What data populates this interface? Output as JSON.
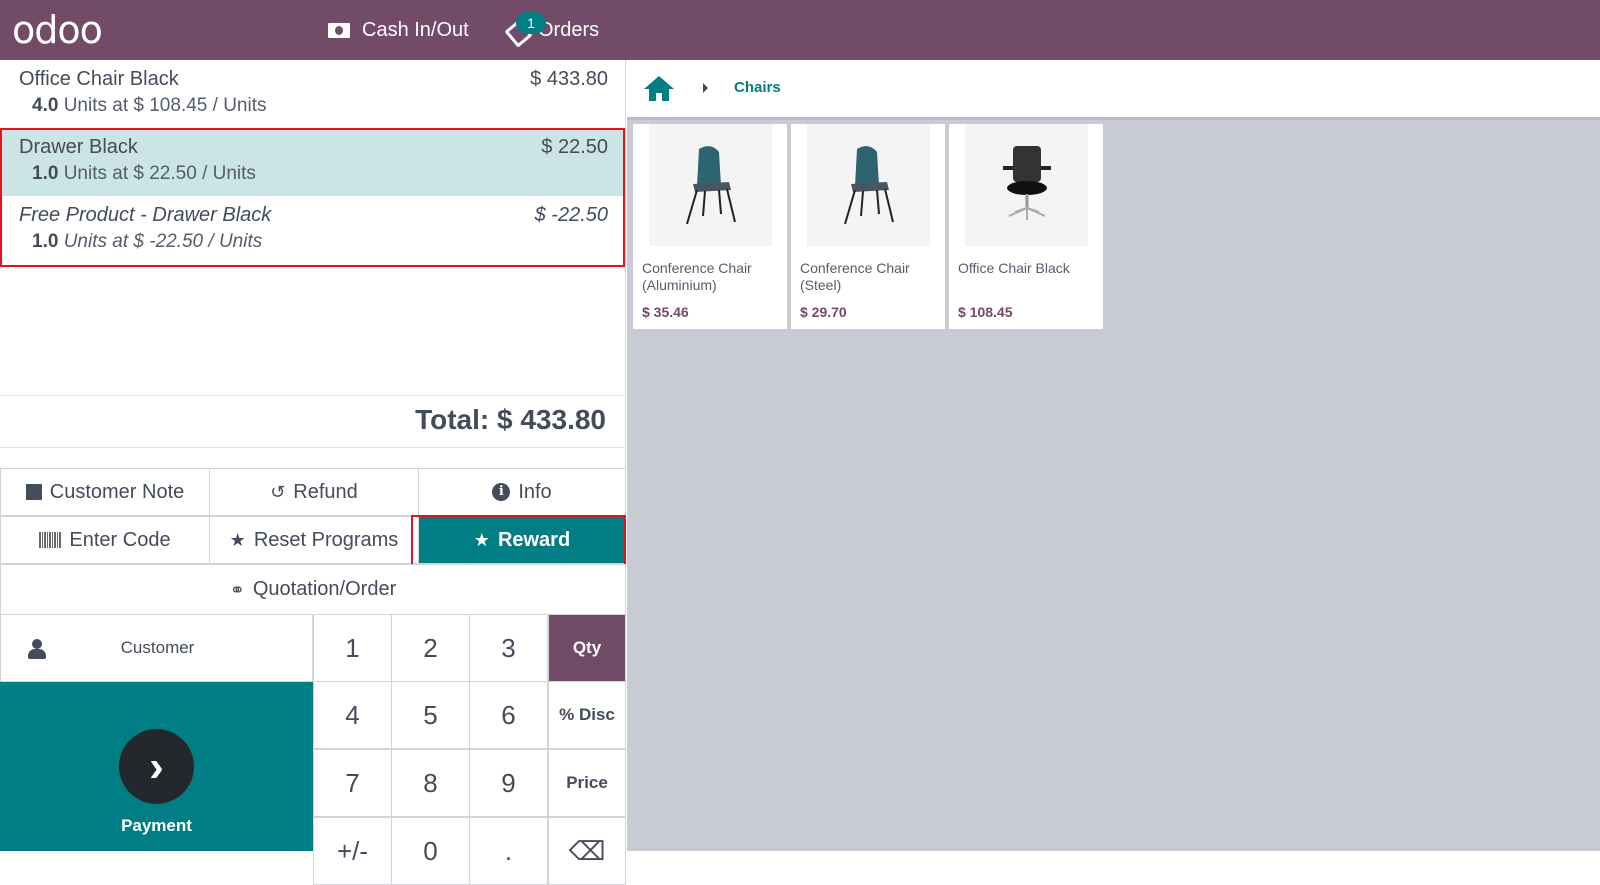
{
  "topbar": {
    "logo": "odoo",
    "cash_label": "Cash In/Out",
    "orders_label": "Orders",
    "orders_badge": "1"
  },
  "orderlines": [
    {
      "name": "Office Chair Black",
      "price": "$ 433.80",
      "qty": "4.0",
      "detail": " Units at $ 108.45 / Units",
      "selected": false,
      "reward": false
    },
    {
      "name": "Drawer Black",
      "price": "$ 22.50",
      "qty": "1.0",
      "detail": " Units at $ 22.50 / Units",
      "selected": true,
      "reward": false
    },
    {
      "name": "Free Product - Drawer Black",
      "price": "$ -22.50",
      "qty": "1.0",
      "detail": " Units at $ -22.50 / Units",
      "selected": false,
      "reward": true
    }
  ],
  "total": "Total: $ 433.80",
  "controls": {
    "customer_note": "Customer Note",
    "refund": "Refund",
    "info": "Info",
    "enter_code": "Enter Code",
    "reset_programs": "Reset Programs",
    "reward": "Reward",
    "quotation": "Quotation/Order"
  },
  "numpad": {
    "customer": "Customer",
    "payment": "Payment",
    "keys": [
      "1",
      "2",
      "3",
      "4",
      "5",
      "6",
      "7",
      "8",
      "9",
      "+/-",
      "0",
      "."
    ],
    "modes": [
      "Qty",
      "% Disc",
      "Price"
    ],
    "active_mode": "Qty"
  },
  "breadcrumb": {
    "category": "Chairs"
  },
  "products": [
    {
      "name": "Conference Chair (Aluminium)",
      "price": "$ 35.46"
    },
    {
      "name": "Conference Chair (Steel)",
      "price": "$ 29.70"
    },
    {
      "name": "Office Chair Black",
      "price": "$ 108.45"
    }
  ],
  "colors": {
    "brand": "#714b67",
    "accent": "#017e84",
    "selected_line": "#cbe4e6",
    "highlight": "#e8121d"
  }
}
